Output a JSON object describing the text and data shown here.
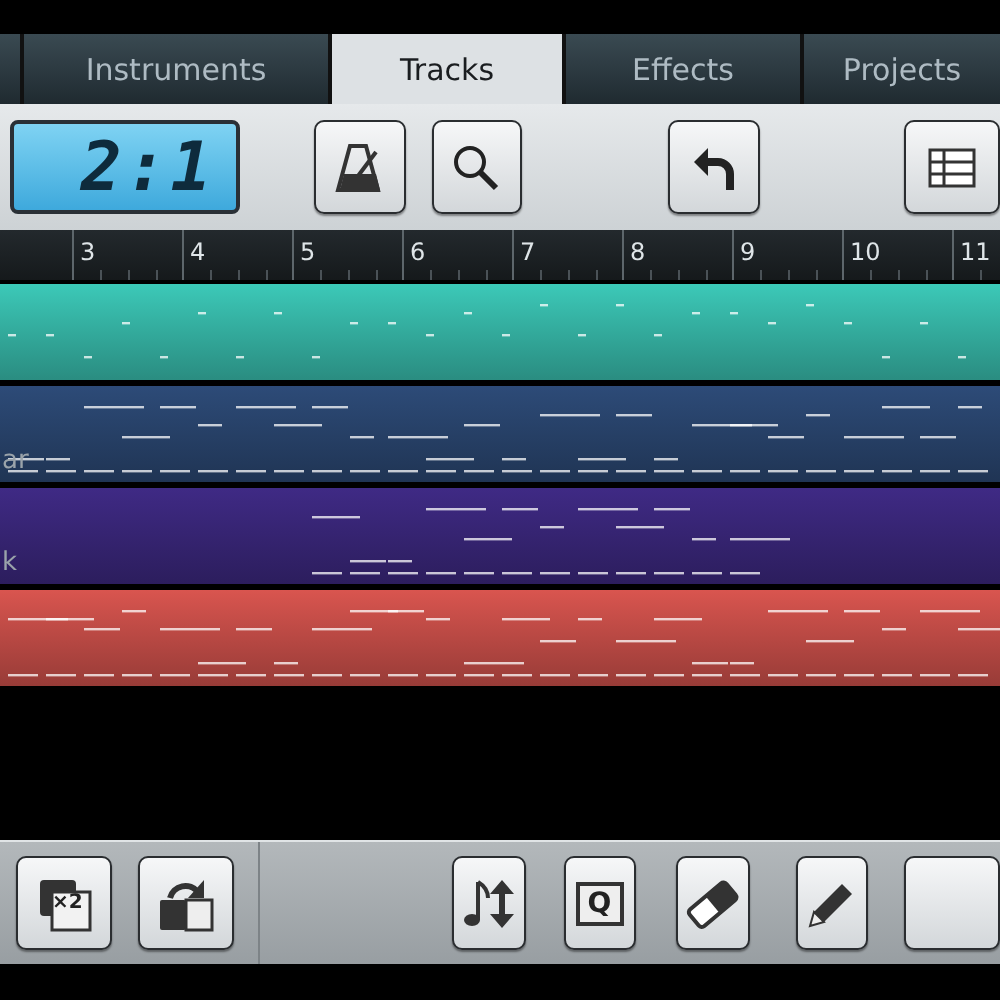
{
  "tabs": [
    {
      "label": "Instruments",
      "selected": false
    },
    {
      "label": "Tracks",
      "selected": true
    },
    {
      "label": "Effects",
      "selected": false
    },
    {
      "label": "Projects",
      "selected": false
    }
  ],
  "toolbar": {
    "position": "2:1"
  },
  "ruler": {
    "bars": [
      "3",
      "4",
      "5",
      "6",
      "7",
      "8",
      "9",
      "10",
      "11"
    ]
  },
  "tracks": [
    {
      "color": "#3cc9b8"
    },
    {
      "name": "ar",
      "color": "#2d4b78"
    },
    {
      "name": "k",
      "color": "#3f2a85"
    },
    {
      "color": "#d9554f"
    }
  ],
  "bottom_toolbar": {
    "duplicate_label": "×2",
    "quantize_label": "Q"
  }
}
